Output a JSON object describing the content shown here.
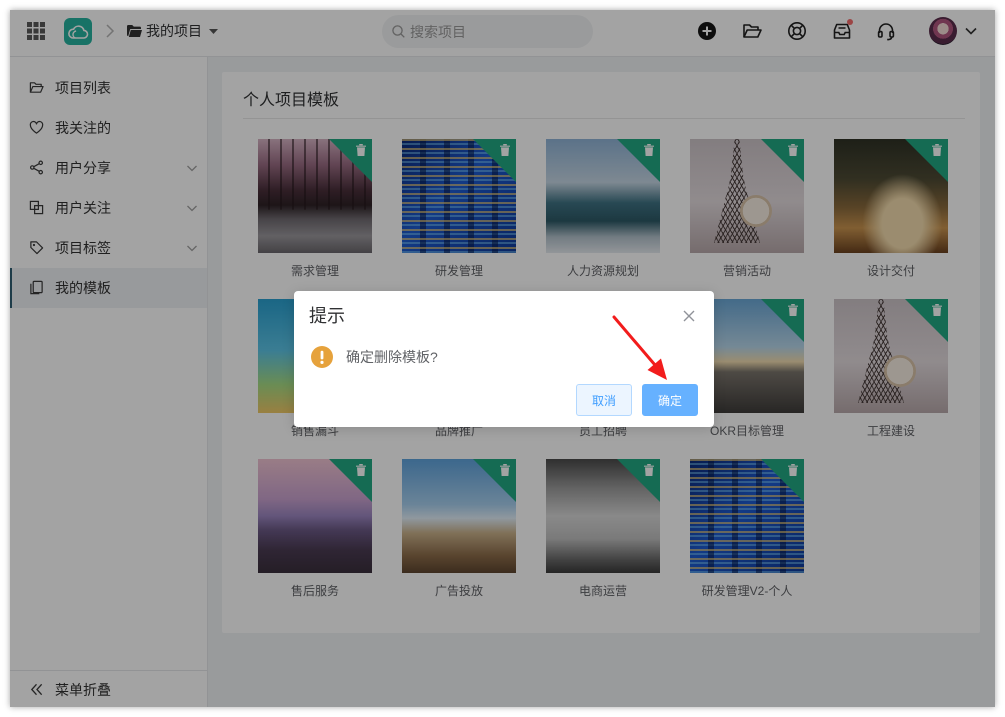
{
  "topbar": {
    "breadcrumb_current": "我的项目",
    "search_placeholder": "搜索项目",
    "icons": [
      "apps-grid-icon",
      "cloud-logo-icon",
      "chevron-right-icon",
      "folder-icon",
      "caret-down-icon",
      "search-icon",
      "plus-circle-icon",
      "folder-open-icon",
      "lifebuoy-icon",
      "inbox-icon",
      "headset-icon",
      "avatar",
      "chevron-down-icon"
    ]
  },
  "sidebar": {
    "items": [
      {
        "label": "项目列表",
        "icon": "folder-open-icon"
      },
      {
        "label": "我关注的",
        "icon": "heart-icon"
      },
      {
        "label": "用户分享",
        "icon": "share-icon",
        "expandable": true
      },
      {
        "label": "用户关注",
        "icon": "copy-icon",
        "expandable": true
      },
      {
        "label": "项目标签",
        "icon": "tag-icon",
        "expandable": true
      },
      {
        "label": "我的模板",
        "icon": "template-icon",
        "active": true
      }
    ],
    "collapse_label": "菜单折叠",
    "collapse_icon": "double-chevron-left-icon"
  },
  "main": {
    "section_title": "个人项目模板",
    "templates": [
      {
        "name": "需求管理"
      },
      {
        "name": "研发管理"
      },
      {
        "name": "人力资源规划"
      },
      {
        "name": "营销活动"
      },
      {
        "name": "设计交付"
      },
      {
        "name": "销售漏斗"
      },
      {
        "name": "品牌推广"
      },
      {
        "name": "员工招聘"
      },
      {
        "name": "OKR目标管理"
      },
      {
        "name": "工程建设"
      },
      {
        "name": "售后服务"
      },
      {
        "name": "广告投放"
      },
      {
        "name": "电商运营"
      },
      {
        "name": "研发管理V2-个人"
      }
    ]
  },
  "dialog": {
    "title": "提示",
    "message": "确定删除模板?",
    "cancel_label": "取消",
    "confirm_label": "确定",
    "icon": "warning-icon"
  },
  "colors": {
    "brand": "#26b3a0",
    "accent": "#409eff",
    "template_badge": "#22a883",
    "warning": "#e6a23c",
    "notification_dot": "#f56c6c",
    "annotation_arrow": "#f21c1c"
  }
}
